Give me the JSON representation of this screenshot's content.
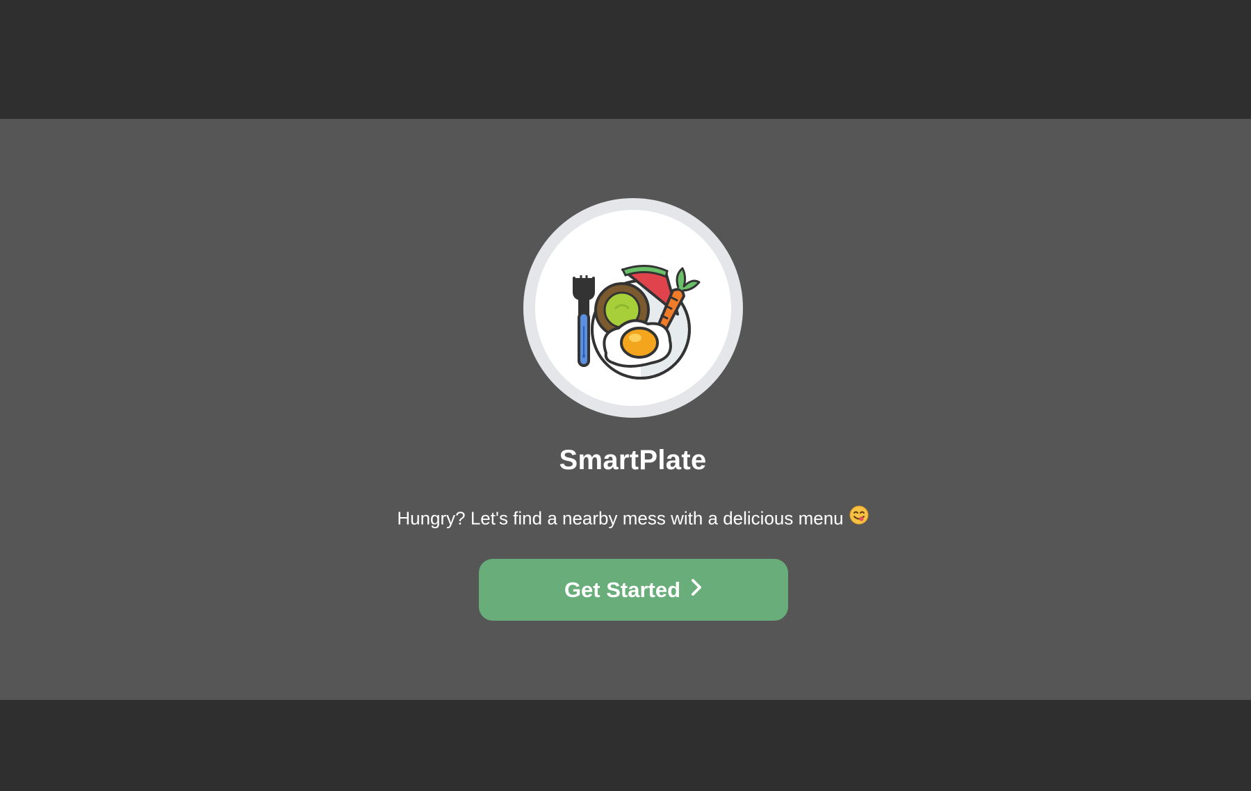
{
  "app": {
    "title": "SmartPlate",
    "tagline": "Hungry? Let's find a nearby mess with a delicious menu"
  },
  "logo": {
    "icon": "plate-fork-food-icon"
  },
  "tagline_emoji": {
    "icon": "yum-face-emoji-icon"
  },
  "cta": {
    "label": "Get Started",
    "icon": "chevron-right-icon"
  },
  "colors": {
    "top_band": "#2f2f2f",
    "hero_background": "#565656",
    "bottom_band": "#2f2f2f",
    "button": "#69ae7a",
    "text": "#ffffff",
    "logo_ring": "#e4e6ea"
  }
}
